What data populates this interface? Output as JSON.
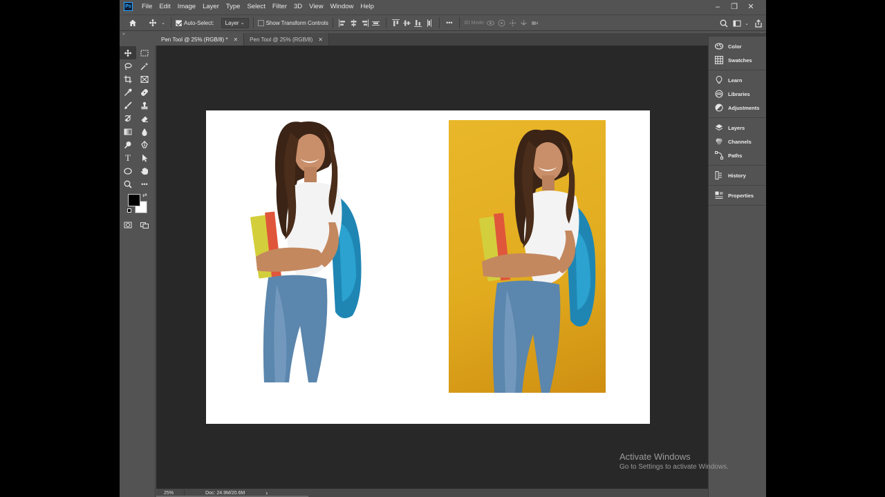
{
  "app": {
    "logo": "Ps"
  },
  "menu": [
    "File",
    "Edit",
    "Image",
    "Layer",
    "Type",
    "Select",
    "Filter",
    "3D",
    "View",
    "Window",
    "Help"
  ],
  "window_controls": {
    "minimize": "–",
    "restore": "❐",
    "close": "✕"
  },
  "options": {
    "auto_select_label": "Auto-Select:",
    "auto_select_checked": true,
    "auto_select_target": "Layer",
    "transform_label": "Show Transform Controls",
    "transform_checked": false,
    "mode_3d_label": "3D Mode:",
    "more_icon": "•••"
  },
  "tabs": [
    {
      "label": "Pen Tool @ 25% (RGB/8) *",
      "close": "✕",
      "active": true
    },
    {
      "label": "Pen Tool @ 25% (RGB/8)",
      "close": "✕",
      "active": false
    }
  ],
  "tools": {
    "type_tool_glyph": "T",
    "more_tools_glyph": "•••"
  },
  "colors": {
    "foreground": "#000000",
    "background": "#ffffff",
    "photo_background": "#e2ac1f"
  },
  "status": {
    "zoom": "25%",
    "doc_size": "Doc: 24.9M/20.6M",
    "arrow": "›"
  },
  "panels": [
    [
      {
        "label": "Color",
        "icon": "color-wheel-icon"
      },
      {
        "label": "Swatches",
        "icon": "swatches-grid-icon"
      }
    ],
    [
      {
        "label": "Learn",
        "icon": "lightbulb-icon"
      },
      {
        "label": "Libraries",
        "icon": "libraries-icon"
      },
      {
        "label": "Adjustments",
        "icon": "adjustments-icon"
      }
    ],
    [
      {
        "label": "Layers",
        "icon": "layers-icon"
      },
      {
        "label": "Channels",
        "icon": "channels-icon"
      },
      {
        "label": "Paths",
        "icon": "paths-icon"
      }
    ],
    [
      {
        "label": "History",
        "icon": "history-icon"
      }
    ],
    [
      {
        "label": "Properties",
        "icon": "properties-icon"
      }
    ]
  ],
  "watermark": {
    "title": "Activate Windows",
    "subtitle": "Go to Settings to activate Windows."
  }
}
